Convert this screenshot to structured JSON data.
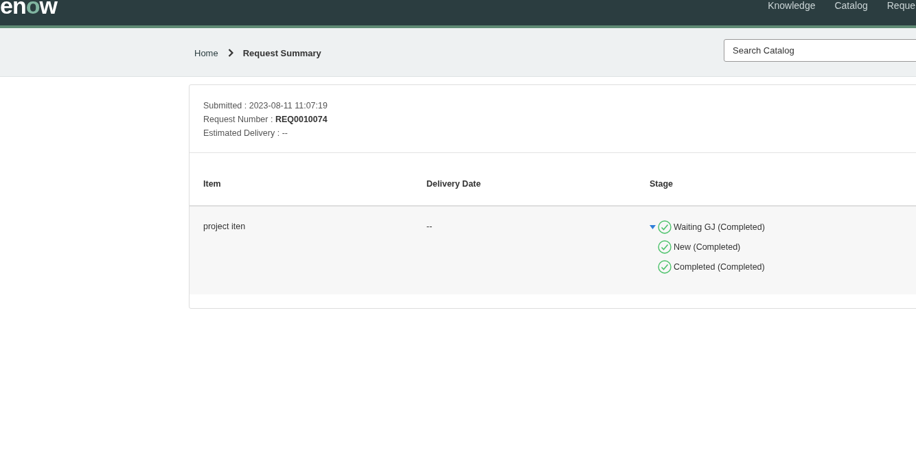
{
  "header": {
    "logo": {
      "start": "en",
      "accent": "o",
      "end": "w"
    },
    "nav": [
      "Knowledge",
      "Catalog",
      "Reque"
    ]
  },
  "breadcrumb": {
    "items": [
      "Home",
      "Request Summary"
    ]
  },
  "search": {
    "placeholder": "Search Catalog"
  },
  "summary": [
    {
      "label": "Submitted :",
      "value": "2023-08-11 11:07:19",
      "bold": false
    },
    {
      "label": "Request Number :",
      "value": "REQ0010074",
      "bold": true
    },
    {
      "label": "Estimated Delivery :",
      "value": "--",
      "bold": false
    }
  ],
  "table": {
    "columns": [
      "Item",
      "Delivery Date",
      "Stage"
    ],
    "rows": [
      {
        "item": "project iten",
        "delivery_date": "--",
        "expanded": true,
        "stages": [
          {
            "label": "Waiting GJ (Completed)",
            "completed": true
          },
          {
            "label": "New (Completed)",
            "completed": true
          },
          {
            "label": "Completed (Completed)",
            "completed": true
          }
        ]
      }
    ]
  }
}
